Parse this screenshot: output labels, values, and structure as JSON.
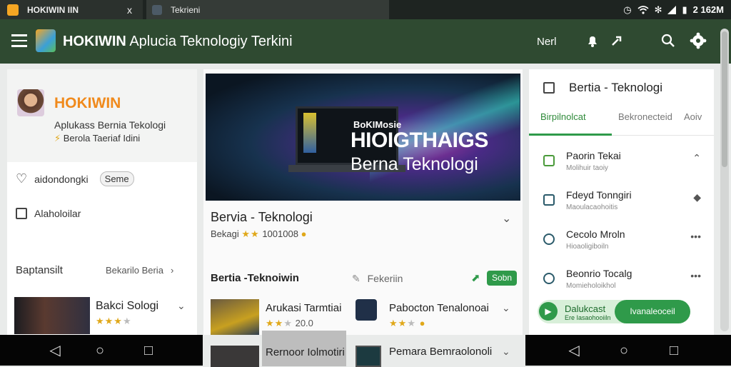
{
  "statusbar": {
    "tab1_title": "HOKIWIN IIN",
    "tab1_close": "x",
    "tab2_title": "Tekrieni",
    "clock": "2 162M"
  },
  "appbar": {
    "brand": "HOKIWIN",
    "title_rest": "Aplucia Teknologiy Terkini",
    "near_label": "Nerl"
  },
  "profile": {
    "name": "HOKIWIN",
    "subtitle1": "Aplukass Bernia Tekologi",
    "subtitle2": "Berola Taeriaf Idini"
  },
  "left_list": {
    "row1_label": "aidondongki",
    "row1_pill": "Seme",
    "row2_label": "Alaholoilar",
    "row3_left": "Baptansilt",
    "row3_right": "Bekarilo Beria",
    "item_title": "Bakci Sologi"
  },
  "hero": {
    "line1": "BoKIMosie",
    "line2": "HIOIGTHAIGS",
    "line3": "Berna Teknologi"
  },
  "center": {
    "title": "Bervia - Teknologi",
    "subtitle": "Bekagi",
    "rating_text": "1001008",
    "section_title": "Bertia -Teknoiwin",
    "featured_label": "Fekeriin",
    "so_button": "Sobn",
    "items": [
      {
        "title": "Arukasi Tarmtiai",
        "rating": "20.0"
      },
      {
        "title": "Pabocton Tenalonoai"
      },
      {
        "title": "Rernoor Iolmotiri"
      },
      {
        "title": "Pemara Bemraolonoli"
      }
    ]
  },
  "right": {
    "title": "Bertia - Teknologi",
    "tabs": [
      "Birpilnolcat",
      "Bekronecteid",
      "Aoiv"
    ],
    "items": [
      {
        "title": "Paorin Tekai",
        "sub": "Molihuir taoiy"
      },
      {
        "title": "Fdeyd Tonngiri",
        "sub": "Maoulacaohoitis"
      },
      {
        "title": "Cecolo Mroln",
        "sub": "Hioaoligiboiln"
      },
      {
        "title": "Beonrio Tocalg",
        "sub": "Momieholoikhol"
      }
    ],
    "cta_title": "Dalukcast",
    "cta_sub": "Ere Iasaohooiiln",
    "cta_button": "Ivanaleoceil"
  }
}
